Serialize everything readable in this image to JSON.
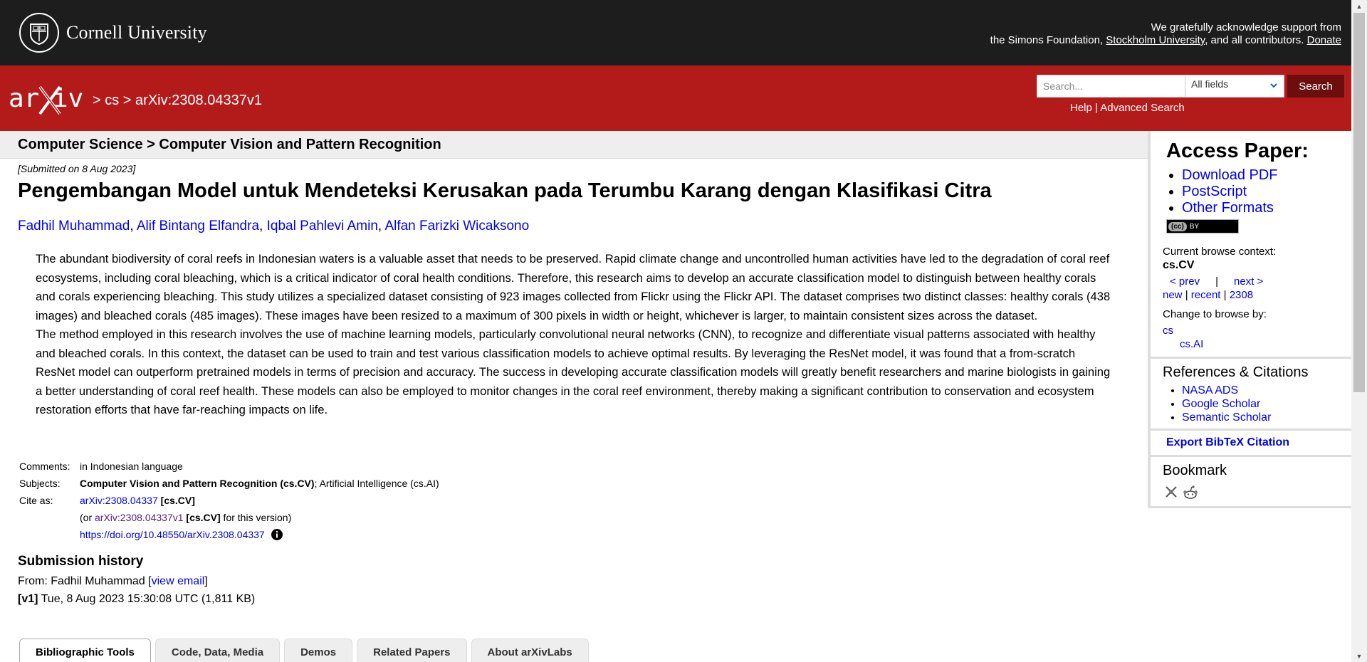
{
  "header": {
    "cornell_name": "Cornell University",
    "support_line1": "We gratefully acknowledge support from",
    "support_prefix": "the Simons Foundation, ",
    "support_link": "Stockholm University",
    "support_suffix": ", and all contributors. ",
    "donate": "Donate"
  },
  "nav": {
    "crumb": "> cs > arXiv:2308.04337v1",
    "search_placeholder": "Search...",
    "field_selected": "All fields",
    "search_button": "Search",
    "help": "Help",
    "help_sep": " | ",
    "advanced": "Advanced Search"
  },
  "subject_header": "Computer Science > Computer Vision and Pattern Recognition",
  "paper": {
    "submitted": "[Submitted on 8 Aug 2023]",
    "title": "Pengembangan Model untuk Mendeteksi Kerusakan pada Terumbu Karang dengan Klasifikasi Citra",
    "authors": [
      "Fadhil Muhammad",
      "Alif Bintang Elfandra",
      "Iqbal Pahlevi Amin",
      "Alfan Farizki Wicaksono"
    ],
    "abstract_p1": "The abundant biodiversity of coral reefs in Indonesian waters is a valuable asset that needs to be preserved. Rapid climate change and uncontrolled human activities have led to the degradation of coral reef ecosystems, including coral bleaching, which is a critical indicator of coral health conditions. Therefore, this research aims to develop an accurate classification model to distinguish between healthy corals and corals experiencing bleaching. This study utilizes a specialized dataset consisting of 923 images collected from Flickr using the Flickr API. The dataset comprises two distinct classes: healthy corals (438 images) and bleached corals (485 images). These images have been resized to a maximum of 300 pixels in width or height, whichever is larger, to maintain consistent sizes across the dataset.",
    "abstract_p2": "The method employed in this research involves the use of machine learning models, particularly convolutional neural networks (CNN), to recognize and differentiate visual patterns associated with healthy and bleached corals. In this context, the dataset can be used to train and test various classification models to achieve optimal results. By leveraging the ResNet model, it was found that a from-scratch ResNet model can outperform pretrained models in terms of precision and accuracy. The success in developing accurate classification models will greatly benefit researchers and marine biologists in gaining a better understanding of coral reef health. These models can also be employed to monitor changes in the coral reef environment, thereby making a significant contribution to conservation and ecosystem restoration efforts that have far-reaching impacts on life."
  },
  "meta": {
    "comments_label": "Comments:",
    "comments_value": "in Indonesian language",
    "subjects_label": "Subjects:",
    "subjects_primary": "Computer Vision and Pattern Recognition (cs.CV)",
    "subjects_rest": "; Artificial Intelligence (cs.AI)",
    "cite_label": "Cite as:",
    "cite_id": "arXiv:2308.04337",
    "cite_cat": " [cs.CV]",
    "cite_or": "(or ",
    "cite_version_id": "arXiv:2308.04337v1",
    "cite_version_cat": " [cs.CV]",
    "cite_version_suffix": " for this version)",
    "doi": "https://doi.org/10.48550/arXiv.2308.04337"
  },
  "history": {
    "heading": "Submission history",
    "from_prefix": "From: Fadhil Muhammad [",
    "view_email": "view email",
    "from_suffix": "]",
    "v1_label": "[v1]",
    "v1_text": " Tue, 8 Aug 2023 15:30:08 UTC (1,811 KB)"
  },
  "tabs": [
    "Bibliographic Tools",
    "Code, Data, Media",
    "Demos",
    "Related Papers",
    "About arXivLabs"
  ],
  "sidebar": {
    "access_heading": "Access Paper:",
    "access_links": [
      "Download PDF",
      "PostScript",
      "Other Formats"
    ],
    "license_text": "BY",
    "license_cc": "(cc)",
    "browse_context_label": "Current browse context:",
    "browse_context": "cs.CV",
    "prev": "< prev",
    "nav_sep": "|",
    "next": "next >",
    "new": "new",
    "recent": "recent",
    "month": "2308",
    "pipe": " | ",
    "change_label": "Change to browse by:",
    "browse_cs": "cs",
    "browse_csai": "cs.AI",
    "refs_heading": "References & Citations",
    "refs_links": [
      "NASA ADS",
      "Google Scholar",
      "Semantic Scholar"
    ],
    "bibtex": "Export BibTeX Citation",
    "bookmark_heading": "Bookmark"
  },
  "colors": {
    "arxiv_red": "#b31b1b",
    "top_black": "#1d1d1d",
    "link_blue": "#0000ee",
    "search_btn": "#6c0e0e"
  }
}
